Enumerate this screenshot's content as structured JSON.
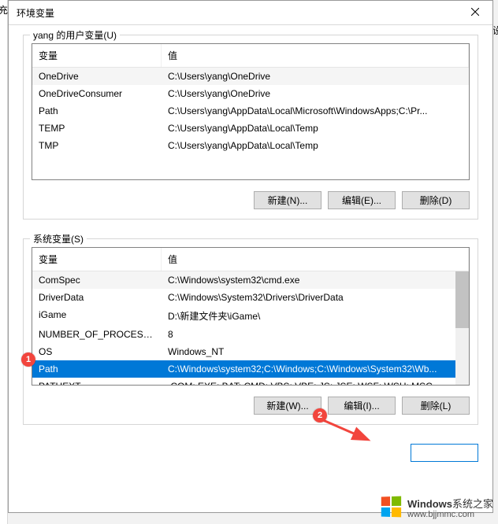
{
  "dialog": {
    "title": "环境变量",
    "close_icon": "close"
  },
  "user_group": {
    "legend": "yang 的用户变量(U)",
    "header_var": "变量",
    "header_val": "值",
    "rows": [
      {
        "var": "OneDrive",
        "val": "C:\\Users\\yang\\OneDrive"
      },
      {
        "var": "OneDriveConsumer",
        "val": "C:\\Users\\yang\\OneDrive"
      },
      {
        "var": "Path",
        "val": "C:\\Users\\yang\\AppData\\Local\\Microsoft\\WindowsApps;C:\\Pr..."
      },
      {
        "var": "TEMP",
        "val": "C:\\Users\\yang\\AppData\\Local\\Temp"
      },
      {
        "var": "TMP",
        "val": "C:\\Users\\yang\\AppData\\Local\\Temp"
      }
    ],
    "buttons": {
      "new": "新建(N)...",
      "edit": "编辑(E)...",
      "delete": "删除(D)"
    }
  },
  "system_group": {
    "legend": "系统变量(S)",
    "header_var": "变量",
    "header_val": "值",
    "rows": [
      {
        "var": "ComSpec",
        "val": "C:\\Windows\\system32\\cmd.exe"
      },
      {
        "var": "DriverData",
        "val": "C:\\Windows\\System32\\Drivers\\DriverData"
      },
      {
        "var": "iGame",
        "val": "D:\\新建文件夹\\iGame\\"
      },
      {
        "var": "NUMBER_OF_PROCESSORS",
        "val": "8"
      },
      {
        "var": "OS",
        "val": "Windows_NT"
      },
      {
        "var": "Path",
        "val": "C:\\Windows\\system32;C:\\Windows;C:\\Windows\\System32\\Wb...",
        "selected": true
      },
      {
        "var": "PATHEXT",
        "val": ".COM;.EXE;.BAT;.CMD;.VBS;.VBE;.JS;.JSE;.WSF;.WSH;.MSC"
      }
    ],
    "buttons": {
      "new": "新建(W)...",
      "edit": "编辑(I)...",
      "delete": "删除(L)"
    }
  },
  "annotations": {
    "a1": "1",
    "a2": "2"
  },
  "watermark": {
    "brand": "Windows",
    "suffix": "系统之家",
    "url": "www.bjjmmc.com"
  },
  "sliver": {
    "top": "充",
    "right": "设"
  }
}
